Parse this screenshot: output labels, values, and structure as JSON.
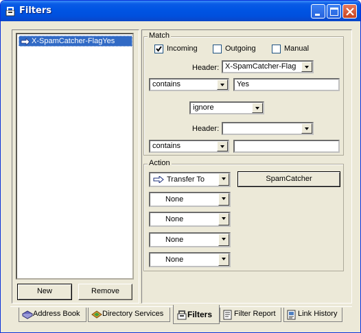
{
  "window": {
    "title": "Filters",
    "icon": "filter-icon"
  },
  "filter_list": {
    "items": [
      {
        "label": "X-SpamCatcher-FlagYes",
        "icon": "arrow-right-icon"
      }
    ]
  },
  "list_buttons": {
    "new": "New",
    "remove": "Remove"
  },
  "match": {
    "label": "Match",
    "incoming": {
      "label": "Incoming",
      "checked": true
    },
    "outgoing": {
      "label": "Outgoing",
      "checked": false
    },
    "manual": {
      "label": "Manual",
      "checked": false
    },
    "header1_label": "Header:",
    "header1_value": "X-SpamCatcher-Flag",
    "condition1": "contains",
    "value1": "Yes",
    "conjunction": "ignore",
    "header2_label": "Header:",
    "header2_value": "",
    "condition2": "contains",
    "value2": ""
  },
  "action": {
    "label": "Action",
    "action1": "Transfer To",
    "target_button": "SpamCatcher",
    "action2": "None",
    "action3": "None",
    "action4": "None",
    "action5": "None"
  },
  "tabs": [
    {
      "label": "Address Book",
      "icon": "address-book-icon"
    },
    {
      "label": "Directory Services",
      "icon": "directory-services-icon"
    },
    {
      "label": "Filters",
      "icon": "filter-icon",
      "active": true
    },
    {
      "label": "Filter Report",
      "icon": "filter-report-icon"
    },
    {
      "label": "Link History",
      "icon": "link-history-icon"
    }
  ]
}
